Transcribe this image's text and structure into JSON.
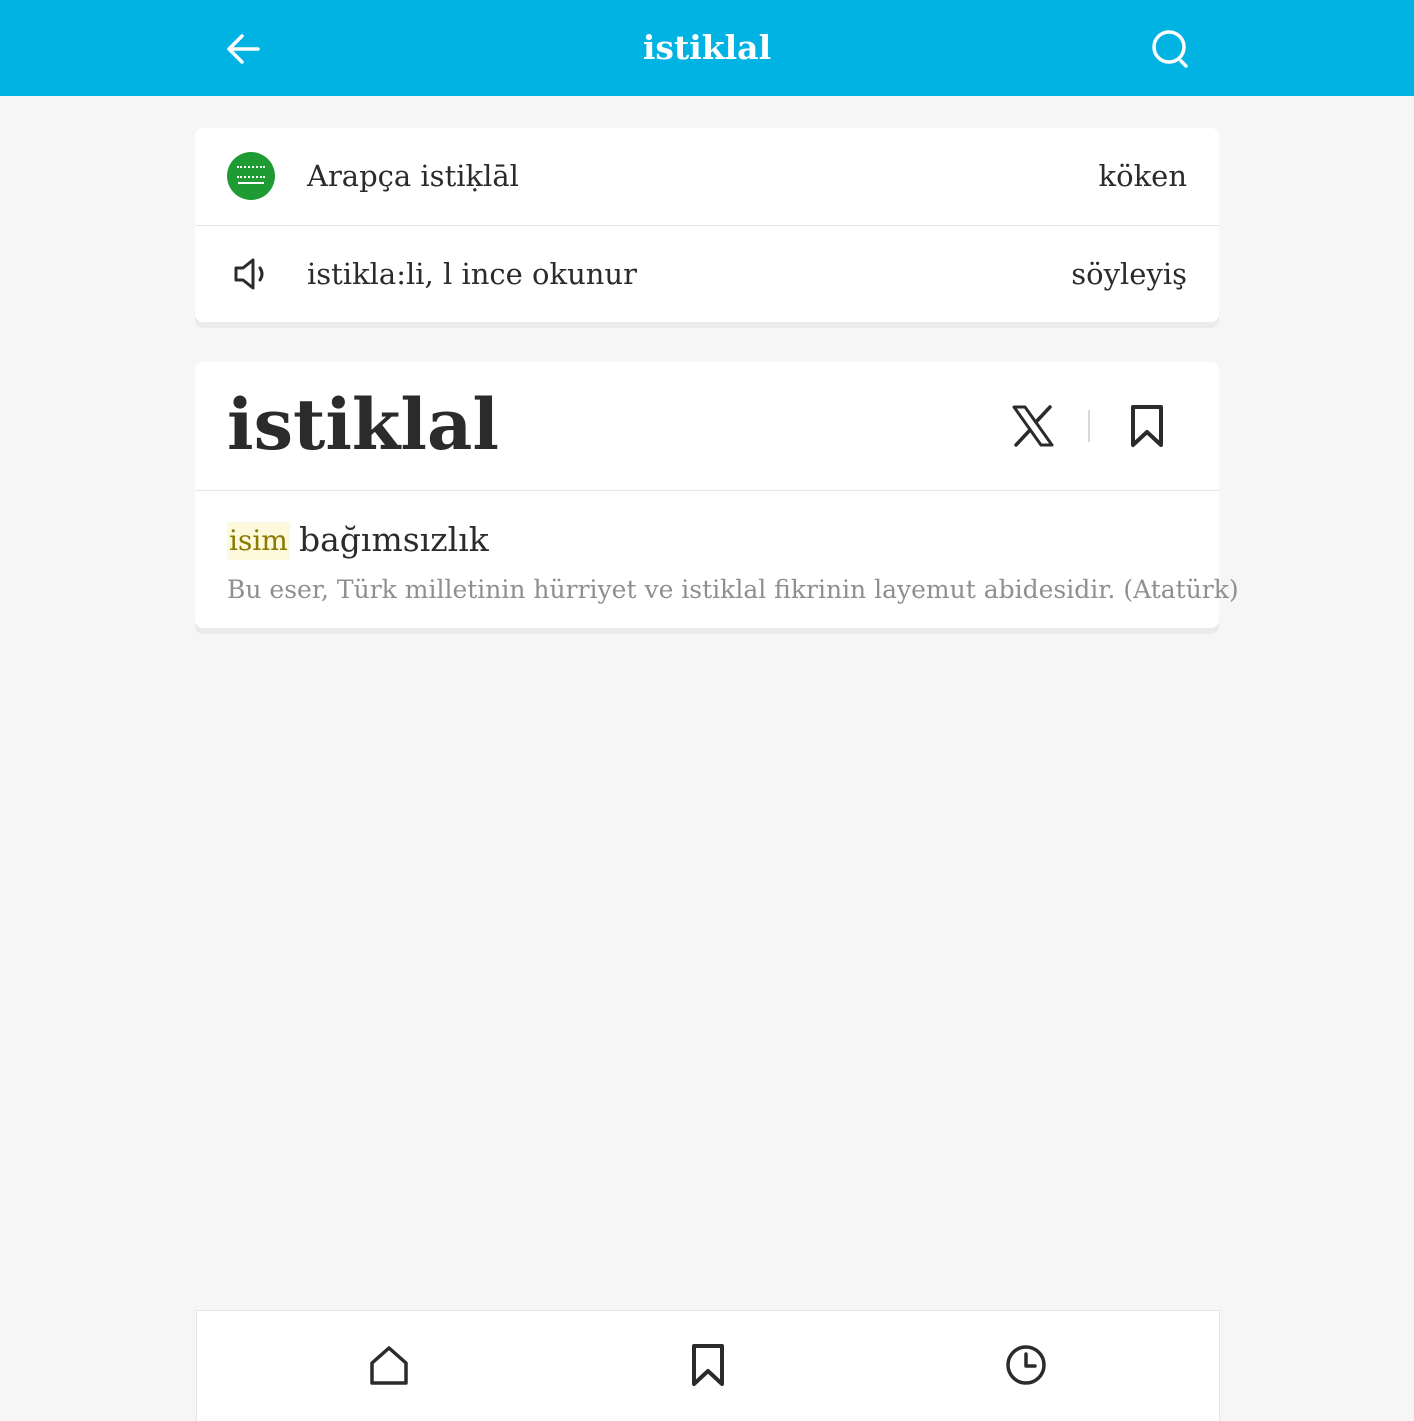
{
  "header": {
    "title": "istiklal",
    "back_icon": "arrow-left-icon",
    "search_icon": "search-icon",
    "background_color": "#00b3e3"
  },
  "info": {
    "origin": {
      "icon": "saudi-arabia-flag-icon",
      "text": "Arapça istiḳlāl",
      "label": "köken"
    },
    "pronunciation": {
      "icon": "speaker-icon",
      "text": "istikla:li, l ince okunur",
      "label": "söyleyiş"
    }
  },
  "entry": {
    "word": "istiklal",
    "share_icon": "x-logo-icon",
    "bookmark_icon": "bookmark-icon",
    "part_of_speech": "isim",
    "meaning": "bağımsızlık",
    "example": "Bu eser, Türk milletinin hürriyet ve istiklal fikrinin layemut abidesidir. (Atatürk)"
  },
  "bottom_nav": {
    "items": [
      {
        "icon": "home-icon"
      },
      {
        "icon": "bookmark-icon"
      },
      {
        "icon": "history-clock-icon"
      }
    ]
  }
}
